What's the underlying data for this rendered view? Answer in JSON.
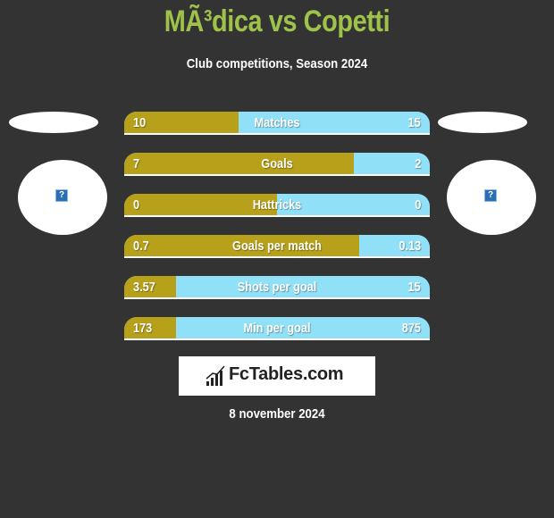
{
  "header": {
    "title": "MÃ³dica vs Copetti",
    "subtitle": "Club competitions, Season 2024"
  },
  "players": {
    "left": {
      "image_icon": "broken-image-icon",
      "icon_glyph": "?"
    },
    "right": {
      "image_icon": "broken-image-icon",
      "icon_glyph": "?"
    }
  },
  "colors": {
    "title": "#9fc24a",
    "left_bar": "#b8a11a",
    "right_bar": "#90e0f8",
    "background": "#333333"
  },
  "stats": [
    {
      "label": "Matches",
      "left": "10",
      "right": "15",
      "left_share": 0.375
    },
    {
      "label": "Goals",
      "left": "7",
      "right": "2",
      "left_share": 0.75
    },
    {
      "label": "Hattricks",
      "left": "0",
      "right": "0",
      "left_share": 0.5
    },
    {
      "label": "Goals per match",
      "left": "0.7",
      "right": "0.13",
      "left_share": 0.77
    },
    {
      "label": "Shots per goal",
      "left": "3.57",
      "right": "15",
      "left_share": 0.17
    },
    {
      "label": "Min per goal",
      "left": "173",
      "right": "875",
      "left_share": 0.17
    }
  ],
  "footer": {
    "logo_text": "FcTables.com",
    "logo_icon": "bar-chart-icon",
    "date": "8 november 2024"
  }
}
